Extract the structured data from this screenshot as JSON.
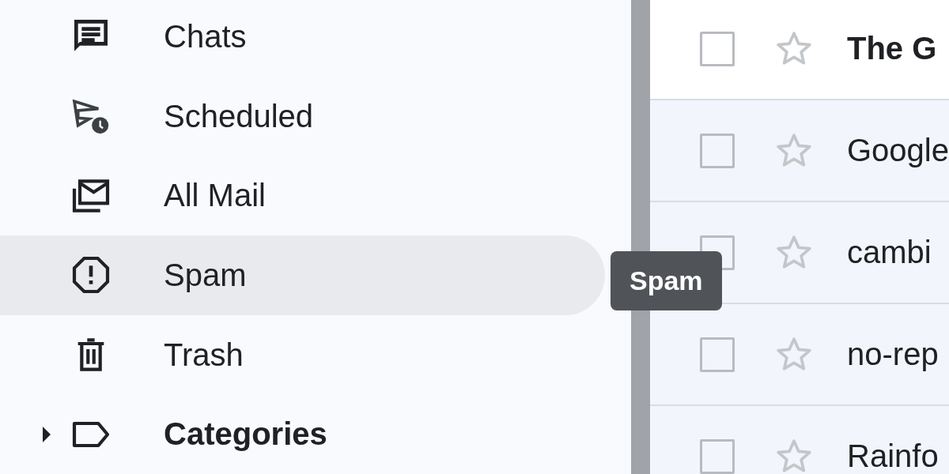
{
  "sidebar": {
    "items": [
      {
        "kind": "link",
        "label": "Chats",
        "selected": false
      },
      {
        "kind": "link",
        "label": "Scheduled",
        "selected": false
      },
      {
        "kind": "link",
        "label": "All Mail",
        "selected": false
      },
      {
        "kind": "link",
        "label": "Spam",
        "selected": true
      },
      {
        "kind": "link",
        "label": "Trash",
        "selected": false
      },
      {
        "kind": "group",
        "label": "Categories",
        "selected": false,
        "expanded": false
      }
    ]
  },
  "tooltip": {
    "text": "Spam"
  },
  "messages": [
    {
      "sender": "The G",
      "unread": true,
      "checked": false,
      "starred": false
    },
    {
      "sender": "Google",
      "unread": false,
      "checked": false,
      "starred": false
    },
    {
      "sender": "cambi",
      "unread": false,
      "checked": false,
      "starred": false
    },
    {
      "sender": "no-rep",
      "unread": false,
      "checked": false,
      "starred": false
    },
    {
      "sender": "Rainfo",
      "unread": false,
      "checked": false,
      "starred": false
    }
  ]
}
